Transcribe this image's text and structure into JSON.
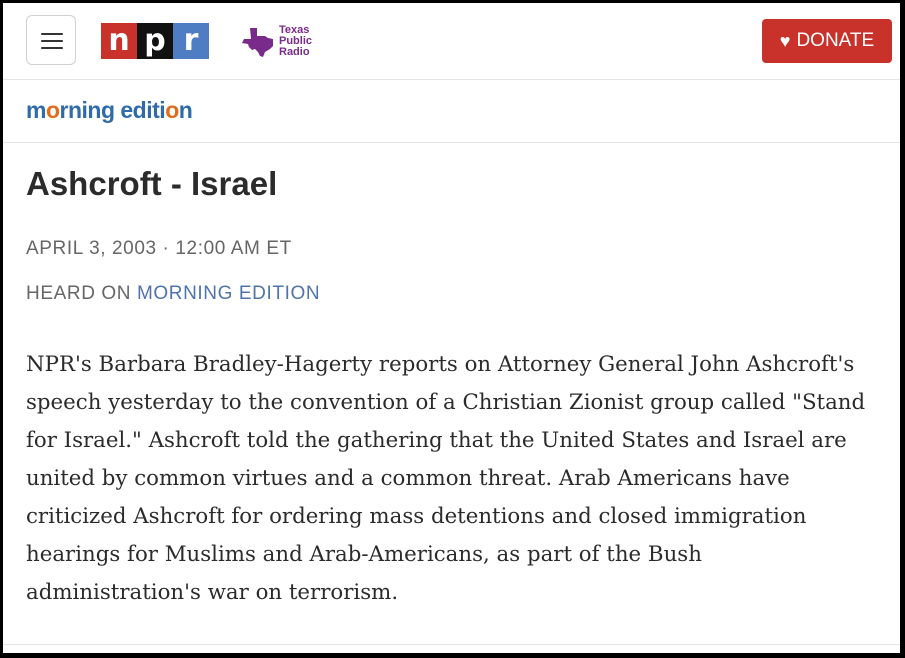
{
  "header": {
    "menu_icon": "hamburger-menu-icon",
    "npr_letters": [
      "n",
      "p",
      "r"
    ],
    "npr_colors": [
      "#c8322b",
      "#111111",
      "#4f7dc4"
    ],
    "station": {
      "line1": "Texas",
      "line2": "Public",
      "line3": "Radio"
    },
    "donate_label": "DONATE",
    "donate_icon": "heart-icon",
    "donate_color": "#c8322b"
  },
  "program": {
    "logo_part1": "m",
    "logo_o1": "o",
    "logo_part2": "rning editi",
    "logo_o2": "o",
    "logo_part3": "n"
  },
  "article": {
    "title": "Ashcroft - Israel",
    "date": "APRIL 3, 2003 · 12:00 AM ET",
    "heard_prefix": "HEARD ON",
    "heard_program": "MORNING EDITION",
    "body": "NPR's Barbara Bradley-Hagerty reports on Attorney General John Ashcroft's speech yesterday to the convention of a Christian Zionist group called \"Stand for Israel.\" Ashcroft told the gathering that the United States and Israel are united by common virtues and a common threat. Arab Americans have criticized Ashcroft for ordering mass detentions and closed immigration hearings for Muslims and Arab-Americans, as part of the Bush administration's war on terrorism."
  }
}
